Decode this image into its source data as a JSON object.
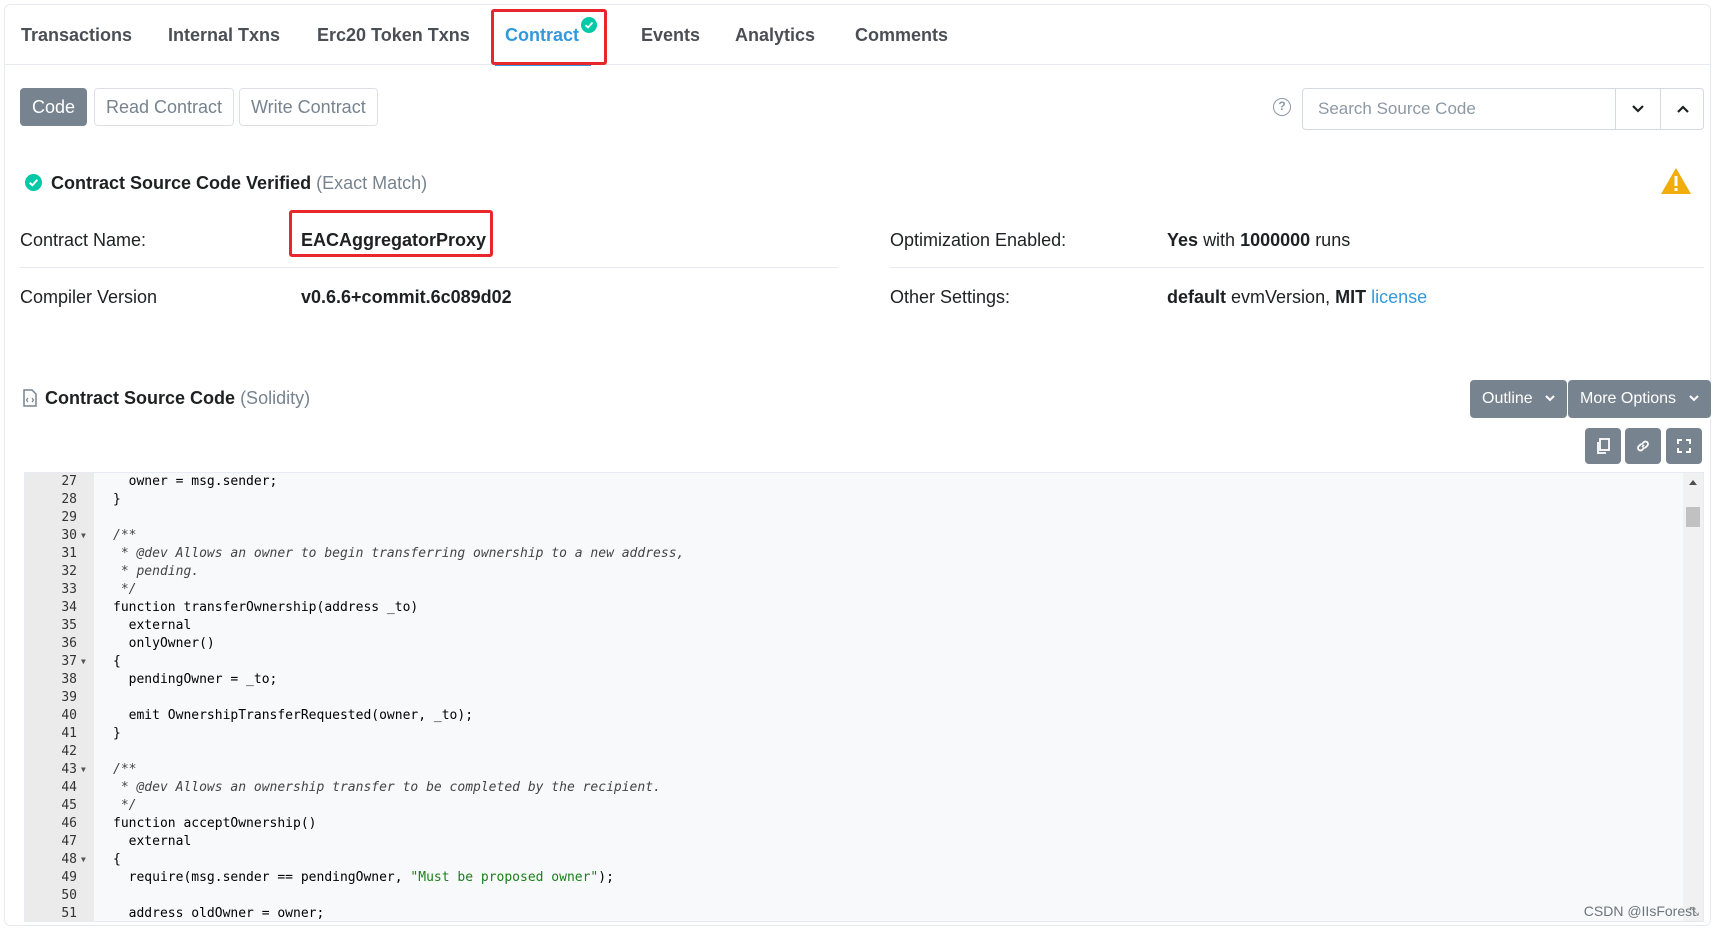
{
  "tabs": [
    {
      "label": "Transactions"
    },
    {
      "label": "Internal Txns"
    },
    {
      "label": "Erc20 Token Txns"
    },
    {
      "label": "Contract",
      "active": true
    },
    {
      "label": "Events"
    },
    {
      "label": "Analytics"
    },
    {
      "label": "Comments"
    }
  ],
  "subtabs": {
    "code": "Code",
    "read": "Read Contract",
    "write": "Write Contract"
  },
  "search": {
    "placeholder": "Search Source Code",
    "help_icon": "question-circle-icon",
    "down_icon": "chevron-down-icon",
    "up_icon": "chevron-up-icon"
  },
  "verified": {
    "title": "Contract Source Code Verified",
    "match": "(Exact Match)",
    "warning_icon": "warning-triangle-icon"
  },
  "info": {
    "contract_name_label": "Contract Name:",
    "contract_name": "EACAggregatorProxy",
    "compiler_label": "Compiler Version",
    "compiler": "v0.6.6+commit.6c089d02",
    "optimization_label": "Optimization Enabled:",
    "optimization_value": "Yes",
    "optimization_with": "with",
    "optimization_runs": "1000000",
    "optimization_runs_suffix": "runs",
    "other_label": "Other Settings:",
    "other_default": "default",
    "other_evm": "evmVersion,",
    "other_license_name": "MIT",
    "other_license_link": "license"
  },
  "source": {
    "title": "Contract Source Code",
    "lang": "(Solidity)",
    "outline_button": "Outline",
    "more_options_button": "More Options"
  },
  "code_lines": [
    {
      "n": "27",
      "fold": false,
      "text": "  owner = msg.sender;",
      "comment": false
    },
    {
      "n": "28",
      "fold": false,
      "text": "}",
      "comment": false
    },
    {
      "n": "29",
      "fold": false,
      "text": "",
      "comment": false
    },
    {
      "n": "30",
      "fold": true,
      "text": "/**",
      "comment": true
    },
    {
      "n": "31",
      "fold": false,
      "text": " * @dev Allows an owner to begin transferring ownership to a new address,",
      "comment": true
    },
    {
      "n": "32",
      "fold": false,
      "text": " * pending.",
      "comment": true
    },
    {
      "n": "33",
      "fold": false,
      "text": " */",
      "comment": true
    },
    {
      "n": "34",
      "fold": false,
      "text": "function transferOwnership(address _to)",
      "comment": false
    },
    {
      "n": "35",
      "fold": false,
      "text": "  external",
      "comment": false
    },
    {
      "n": "36",
      "fold": false,
      "text": "  onlyOwner()",
      "comment": false
    },
    {
      "n": "37",
      "fold": true,
      "text": "{",
      "comment": false
    },
    {
      "n": "38",
      "fold": false,
      "text": "  pendingOwner = _to;",
      "comment": false
    },
    {
      "n": "39",
      "fold": false,
      "text": "",
      "comment": false
    },
    {
      "n": "40",
      "fold": false,
      "text": "  emit OwnershipTransferRequested(owner, _to);",
      "comment": false
    },
    {
      "n": "41",
      "fold": false,
      "text": "}",
      "comment": false
    },
    {
      "n": "42",
      "fold": false,
      "text": "",
      "comment": false
    },
    {
      "n": "43",
      "fold": true,
      "text": "/**",
      "comment": true
    },
    {
      "n": "44",
      "fold": false,
      "text": " * @dev Allows an ownership transfer to be completed by the recipient.",
      "comment": true
    },
    {
      "n": "45",
      "fold": false,
      "text": " */",
      "comment": true
    },
    {
      "n": "46",
      "fold": false,
      "text": "function acceptOwnership()",
      "comment": false
    },
    {
      "n": "47",
      "fold": false,
      "text": "  external",
      "comment": false
    },
    {
      "n": "48",
      "fold": true,
      "text": "{",
      "comment": false
    },
    {
      "n": "49",
      "fold": false,
      "text": "  require(msg.sender == pendingOwner, ",
      "string": "\"Must be proposed owner\"",
      "after": ");",
      "comment": false
    },
    {
      "n": "50",
      "fold": false,
      "text": "",
      "comment": false
    },
    {
      "n": "51",
      "fold": false,
      "text": "  address oldOwner = owner;",
      "comment": false
    }
  ],
  "watermark": "CSDN @IIsForest",
  "colors": {
    "accent": "#3498db",
    "success": "#00c9a7",
    "warning": "#f0ad0b",
    "highlight_box": "#e8262b",
    "button_gray": "#77838f"
  }
}
